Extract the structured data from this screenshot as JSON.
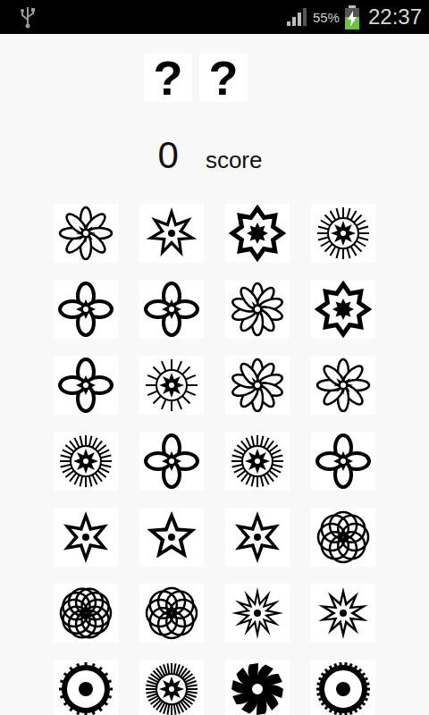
{
  "status_bar": {
    "usb_connected": true,
    "signal": {
      "level": 0.75
    },
    "battery": {
      "reading": "55%",
      "level": 0.55,
      "charging": true
    },
    "time": "22:37"
  },
  "slots": [
    "?",
    "?"
  ],
  "score": {
    "value": "0",
    "label": "score"
  },
  "tiles": [
    {
      "face_up": true
    },
    {
      "face_up": true
    },
    {
      "face_up": true
    },
    {
      "face_up": true
    },
    {
      "face_up": true
    },
    {
      "face_up": true
    },
    {
      "face_up": true
    },
    {
      "face_up": true
    },
    {
      "face_up": true
    },
    {
      "face_up": true
    },
    {
      "face_up": true
    },
    {
      "face_up": true
    },
    {
      "face_up": true
    },
    {
      "face_up": true
    },
    {
      "face_up": true
    },
    {
      "face_up": true
    },
    {
      "face_up": true
    },
    {
      "face_up": true
    },
    {
      "face_up": true
    },
    {
      "face_up": true
    },
    {
      "face_up": true
    },
    {
      "face_up": true
    },
    {
      "face_up": true
    },
    {
      "face_up": true
    },
    {
      "face_up": true
    },
    {
      "face_up": true
    },
    {
      "face_up": true
    },
    {
      "face_up": true
    }
  ]
}
